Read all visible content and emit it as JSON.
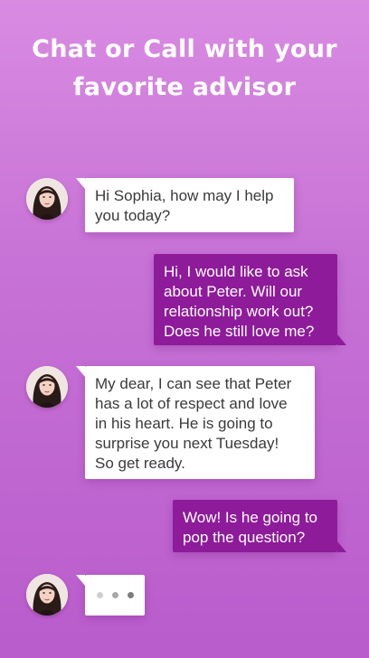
{
  "headline": {
    "line1": "Chat or Call with your",
    "line2": "favorite advisor"
  },
  "colors": {
    "background_top": "#d98be2",
    "background_bottom": "#b95ccc",
    "advisor_bubble": "#ffffff",
    "user_bubble": "#8e1b9a"
  },
  "messages": [
    {
      "sender": "advisor",
      "lines": [
        "Hi Sophia, how may I help",
        "you today?"
      ]
    },
    {
      "sender": "user",
      "lines": [
        "Hi, I would like to ask",
        "about Peter. Will our",
        "relationship work out?",
        "Does he still love me?"
      ]
    },
    {
      "sender": "advisor",
      "lines": [
        "My dear, I can see that Peter",
        "has a lot of respect and love",
        "in his heart. He is going to",
        "surprise you next Tuesday!",
        "So get ready."
      ]
    },
    {
      "sender": "user",
      "lines": [
        "Wow! Is he going to",
        "pop the question?"
      ]
    }
  ],
  "typing_indicator": {
    "icon": "typing-dots-icon"
  },
  "advisor_avatar": {
    "icon": "advisor-portrait"
  }
}
